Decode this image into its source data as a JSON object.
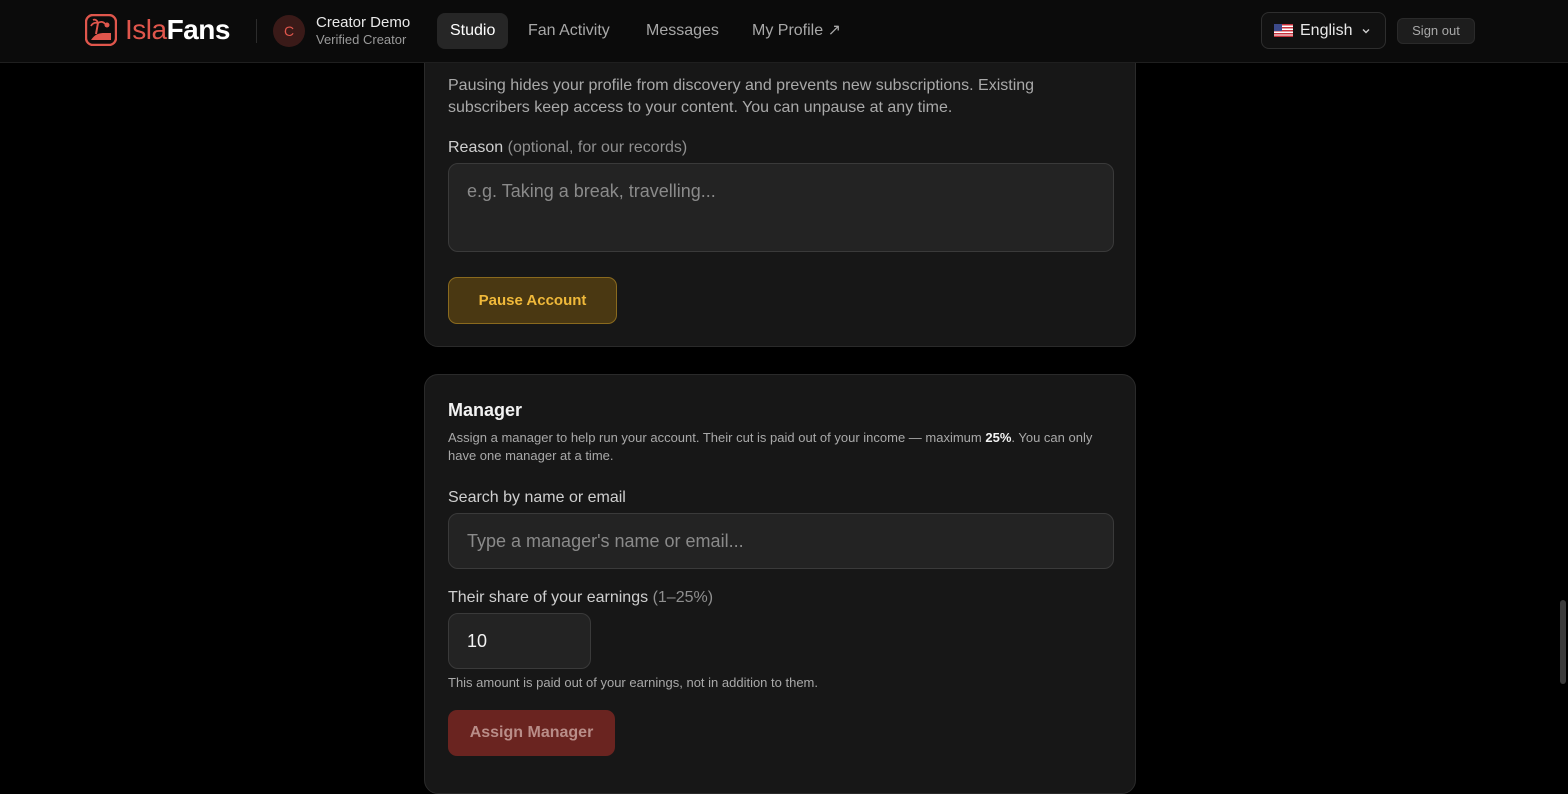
{
  "nav": {
    "brand_a": "Isla",
    "brand_b": "Fans",
    "avatar_initial": "C",
    "user_name": "Creator Demo",
    "user_role": "Verified Creator",
    "items": [
      {
        "label": "Studio",
        "active": true
      },
      {
        "label": "Fan Activity"
      },
      {
        "label": "Messages"
      },
      {
        "label": "My Profile ↗"
      }
    ],
    "language": "English",
    "sign_out": "Sign out"
  },
  "pause_section": {
    "description": "Pausing hides your profile from discovery and prevents new subscriptions. Existing subscribers keep access to your content. You can unpause at any time.",
    "reason_label": "Reason",
    "reason_hint": "(optional, for our records)",
    "reason_placeholder": "e.g. Taking a break, travelling...",
    "button": "Pause Account"
  },
  "manager_section": {
    "title": "Manager",
    "desc_prefix": "Assign a manager to help run your account. Their cut is paid out of your income — maximum ",
    "desc_max": "25%",
    "desc_suffix": ". You can only have one manager at a time.",
    "search_label": "Search by name or email",
    "search_placeholder": "Type a manager's name or email...",
    "share_label": "Their share of your earnings",
    "share_range": "(1–25%)",
    "share_value": "10",
    "share_note": "This amount is paid out of your earnings, not in addition to them.",
    "assign_button": "Assign Manager"
  },
  "colors": {
    "accent_red": "#e0564c",
    "pause_gold": "#f0b93a",
    "assign_red": "#6a2420"
  }
}
